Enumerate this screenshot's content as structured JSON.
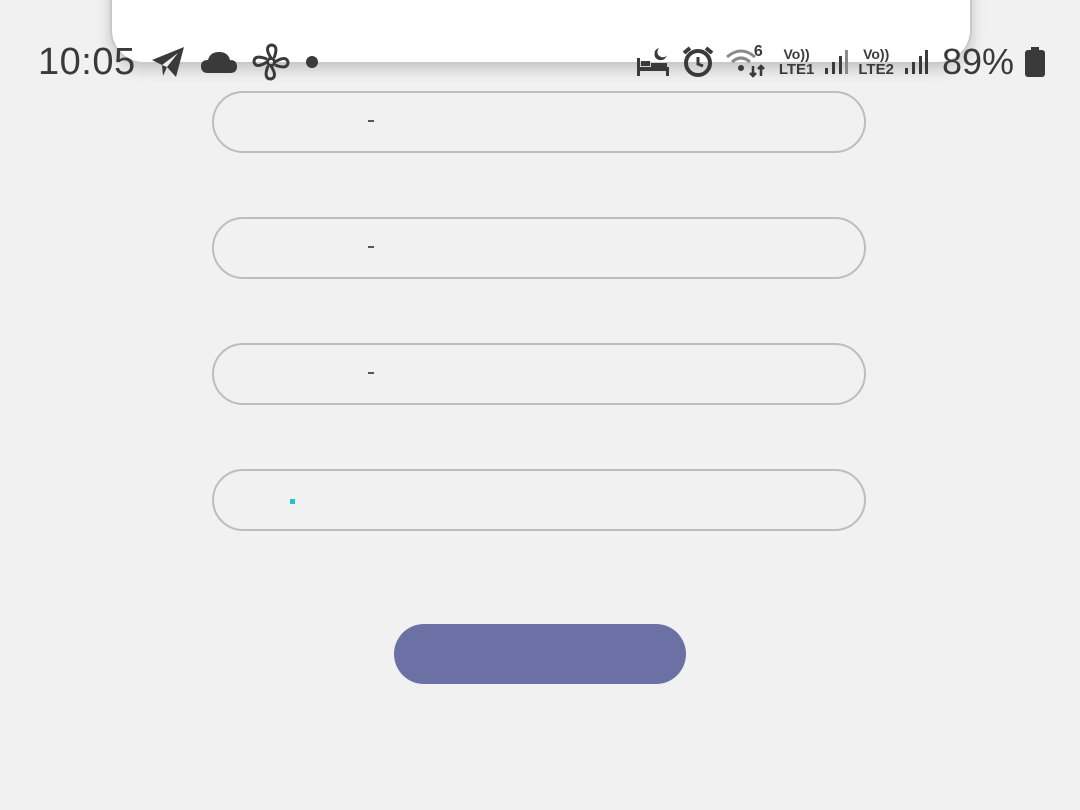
{
  "status_bar": {
    "time": "10:05",
    "battery_percent": "89%",
    "sim1_label_top": "Vo))",
    "sim1_label_bottom": "LTE1",
    "sim2_label_top": "Vo))",
    "sim2_label_bottom": "LTE2",
    "wifi_generation": "6",
    "left_icons": [
      "telegram-icon",
      "cloud-icon",
      "fan-icon",
      "notification-dot-icon"
    ],
    "right_icons": [
      "sleep-mode-icon",
      "alarm-icon",
      "wifi-6-icon",
      "signal-sim1-icon",
      "signal-sim2-icon",
      "battery-icon"
    ]
  },
  "form": {
    "fields": [
      {
        "value": "",
        "placeholder": ""
      },
      {
        "value": "",
        "placeholder": ""
      },
      {
        "value": "",
        "placeholder": ""
      },
      {
        "value": "",
        "placeholder": "",
        "focused": true
      }
    ],
    "submit_label": "",
    "accent_color": "#6b70a5",
    "cursor_color": "#1ec7c7"
  }
}
